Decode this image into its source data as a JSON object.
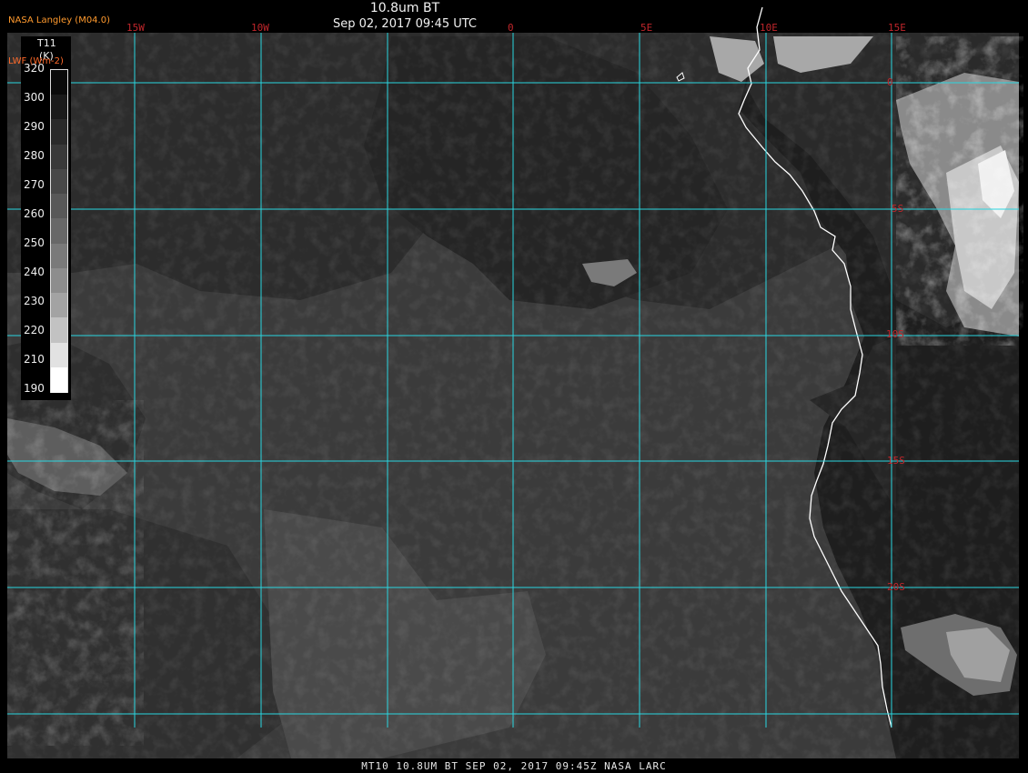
{
  "header": {
    "title": "10.8um BT",
    "datetime": "Sep 02, 2017 09:45 UTC",
    "credit": "NASA Langley (M04.0)",
    "lwf_label": "LWF (Wm-2)"
  },
  "legend": {
    "variable": "T11",
    "unit": "(K)",
    "ticks": [
      "320",
      "300",
      "290",
      "280",
      "270",
      "260",
      "250",
      "240",
      "230",
      "220",
      "210",
      "190"
    ],
    "shades": [
      "#0a0a0a",
      "#1a1a1a",
      "#2a2a2a",
      "#393939",
      "#484848",
      "#585858",
      "#686868",
      "#7a7a7a",
      "#8d8d8d",
      "#a3a3a3",
      "#c2c2c2",
      "#e2e2e2",
      "#ffffff"
    ]
  },
  "grid": {
    "lon_labels": [
      "15W",
      "10W",
      "0",
      "5E",
      "10E",
      "15E"
    ],
    "lat_labels": [
      "0",
      "5S",
      "10S",
      "15S",
      "20S"
    ],
    "line_color": "#29d6e0"
  },
  "footer": {
    "text": "MT10  10.8UM BT   SEP 02, 2017 09:45Z   NASA LARC"
  }
}
